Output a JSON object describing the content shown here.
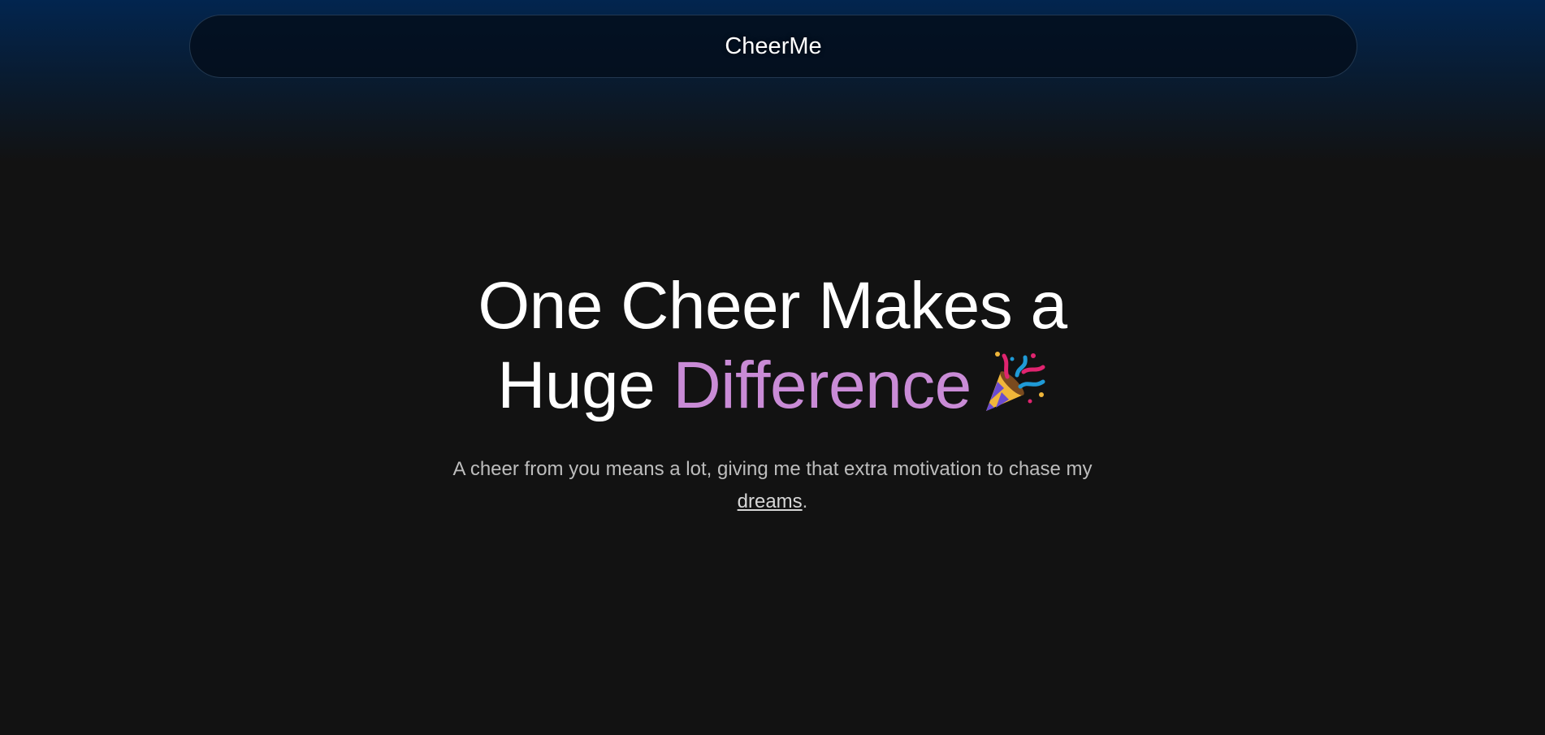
{
  "navbar": {
    "brand": "CheerMe"
  },
  "hero": {
    "headline_line1": "One Cheer Makes a",
    "headline_line2_start": "Huge ",
    "headline_accent": "Difference",
    "emoji_icon": "party-popper-icon",
    "subtitle_before_link": "A cheer from you means a lot, giving me that extra motivation to chase my ",
    "subtitle_link": "dreams",
    "subtitle_after_link": "."
  },
  "colors": {
    "background": "#121212",
    "top_gradient": "#02254f",
    "accent": "#c98bd6",
    "subtitle": "#bdbdbd"
  }
}
